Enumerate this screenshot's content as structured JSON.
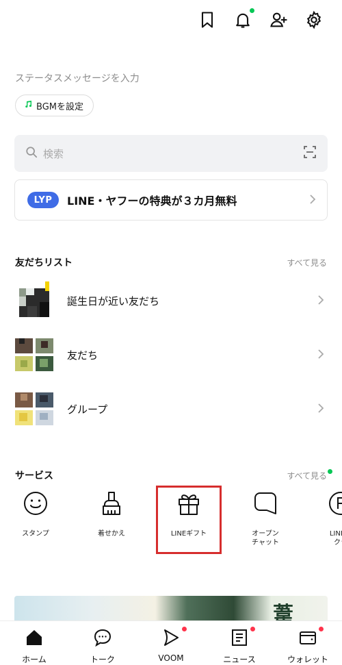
{
  "header": {
    "icons": [
      "bookmark-icon",
      "bell-icon",
      "add-friend-icon",
      "settings-icon"
    ]
  },
  "profile": {
    "status_placeholder": "ステータスメッセージを入力",
    "bgm_label": "BGMを設定"
  },
  "search": {
    "placeholder": "検索"
  },
  "banner": {
    "logo": "LYP",
    "text": "LINE・ヤフーの特典が３カ月無料"
  },
  "friends": {
    "title": "友だちリスト",
    "see_all": "すべて見る",
    "rows": [
      {
        "label": "誕生日が近い友だち"
      },
      {
        "label": "友だち"
      },
      {
        "label": "グループ"
      }
    ]
  },
  "services": {
    "title": "サービス",
    "see_all": "すべて見る",
    "items": [
      {
        "label": "スタンプ",
        "icon": "smiley-icon"
      },
      {
        "label": "着せかえ",
        "icon": "brush-icon"
      },
      {
        "label": "LINEギフト",
        "icon": "gift-icon"
      },
      {
        "label": "オープン\nチャット",
        "icon": "chat-bubble-icon"
      },
      {
        "label": "LINEポ\nクラ",
        "icon": "points-icon"
      }
    ]
  },
  "ad": {
    "visible_char": "葦"
  },
  "bottom_nav": [
    {
      "label": "ホーム",
      "icon": "home-icon",
      "active": true
    },
    {
      "label": "トーク",
      "icon": "talk-icon"
    },
    {
      "label": "VOOM",
      "icon": "voom-icon",
      "badge": true
    },
    {
      "label": "ニュース",
      "icon": "news-icon",
      "badge": true
    },
    {
      "label": "ウォレット",
      "icon": "wallet-icon",
      "badge": true
    }
  ],
  "colors": {
    "accent_green": "#06c755",
    "badge_red": "#ff334b",
    "highlight_red": "#d62d2d",
    "lyp_blue": "#3f6ce6"
  }
}
